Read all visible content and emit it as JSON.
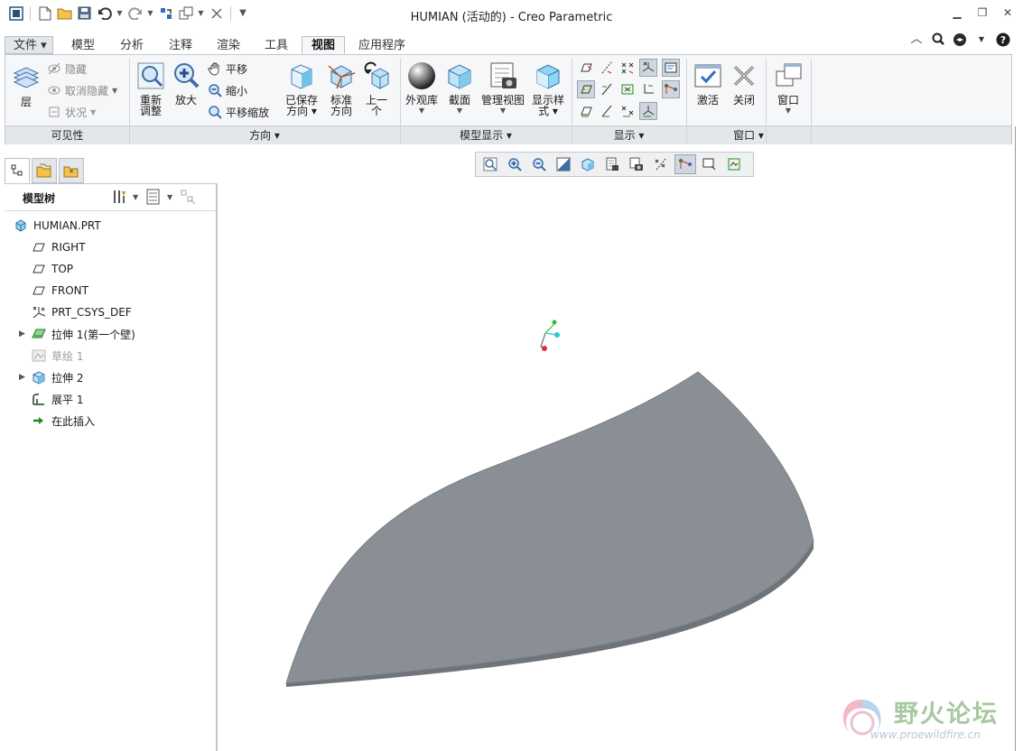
{
  "window": {
    "title": "HUMIAN (活动的) - Creo Parametric"
  },
  "tabs": [
    {
      "label": "文件"
    },
    {
      "label": "模型"
    },
    {
      "label": "分析"
    },
    {
      "label": "注释"
    },
    {
      "label": "渲染"
    },
    {
      "label": "工具"
    },
    {
      "label": "视图"
    },
    {
      "label": "应用程序"
    }
  ],
  "ribbon": {
    "visibility": {
      "group_label": "可见性",
      "layers": "层",
      "hide": "隐藏",
      "unhide": "取消隐藏",
      "status": "状况"
    },
    "orientation": {
      "group_label": "方向",
      "refit_line1": "重新",
      "refit_line2": "调整",
      "zoom_in": "放大",
      "pan": "平移",
      "zoom_out": "缩小",
      "pan_zoom": "平移缩放",
      "saved_line1": "已保存",
      "saved_line2": "方向",
      "standard_line1": "标准",
      "standard_line2": "方向",
      "previous_line1": "上一",
      "previous_line2": "个"
    },
    "model_display": {
      "group_label": "模型显示",
      "appearance": "外观库",
      "section": "截面",
      "manage_views": "管理视图",
      "display_style_line1": "显示样",
      "display_style_line2": "式"
    },
    "show": {
      "group_label": "显示"
    },
    "window": {
      "group_label": "窗口",
      "activate": "激活",
      "close": "关闭",
      "windows": "窗口"
    }
  },
  "model_tree": {
    "title": "模型树",
    "items": [
      {
        "label": "HUMIAN.PRT",
        "icon": "part-icon"
      },
      {
        "label": "RIGHT",
        "icon": "datum-plane-icon"
      },
      {
        "label": "TOP",
        "icon": "datum-plane-icon"
      },
      {
        "label": "FRONT",
        "icon": "datum-plane-icon"
      },
      {
        "label": "PRT_CSYS_DEF",
        "icon": "coordinate-system-icon"
      },
      {
        "label": "拉伸 1(第一个壁)",
        "icon": "sheetmetal-wall-icon"
      },
      {
        "label": "草绘 1",
        "icon": "sketch-icon"
      },
      {
        "label": "拉伸 2",
        "icon": "extrude-icon"
      },
      {
        "label": "展平 1",
        "icon": "unbend-icon"
      },
      {
        "label": "在此插入",
        "icon": "insert-here-arrow-icon"
      }
    ]
  },
  "watermark": {
    "title": "野火论坛",
    "url": "www.proewildfire.cn"
  },
  "colors": {
    "model_fill": "#8a8f96",
    "model_edge": "#6f747b",
    "ribbon_bg": "#f6f7f9",
    "active_tool_bg": "#cfd6de",
    "csys_x": "#e03030",
    "csys_y": "#30c030",
    "csys_z": "#30c8d8"
  }
}
